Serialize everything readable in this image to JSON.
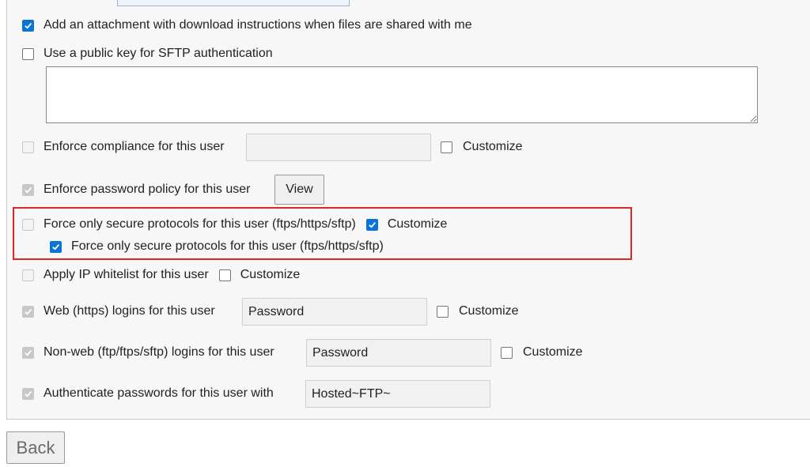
{
  "settings": {
    "attachment": {
      "label": "Add an attachment with download instructions when files are shared with me",
      "checked": true
    },
    "public_key": {
      "label": "Use a public key for SFTP authentication",
      "checked": false,
      "value": ""
    },
    "compliance": {
      "label": "Enforce compliance for this user",
      "value": "",
      "customize_label": "Customize"
    },
    "password_policy": {
      "label": "Enforce password policy for this user",
      "view_label": "View"
    },
    "secure_protocols": {
      "label": "Force only secure protocols for this user (ftps/https/sftp)",
      "customize_label": "Customize",
      "sub_label": "Force only secure protocols for this user (ftps/https/sftp)"
    },
    "ip_whitelist": {
      "label": "Apply IP whitelist for this user",
      "customize_label": "Customize"
    },
    "web_logins": {
      "label": "Web (https) logins for this user",
      "value": "Password",
      "customize_label": "Customize"
    },
    "nonweb_logins": {
      "label": "Non-web (ftp/ftps/sftp) logins for this user",
      "value": "Password",
      "customize_label": "Customize"
    },
    "auth_passwords": {
      "label": "Authenticate passwords for this user with",
      "value": "Hosted~FTP~"
    }
  },
  "footer": {
    "back_label": "Back"
  },
  "colors": {
    "accent": "#0a73d6",
    "highlight": "#e0262d"
  },
  "icons": {
    "checkmark": "check-icon"
  }
}
